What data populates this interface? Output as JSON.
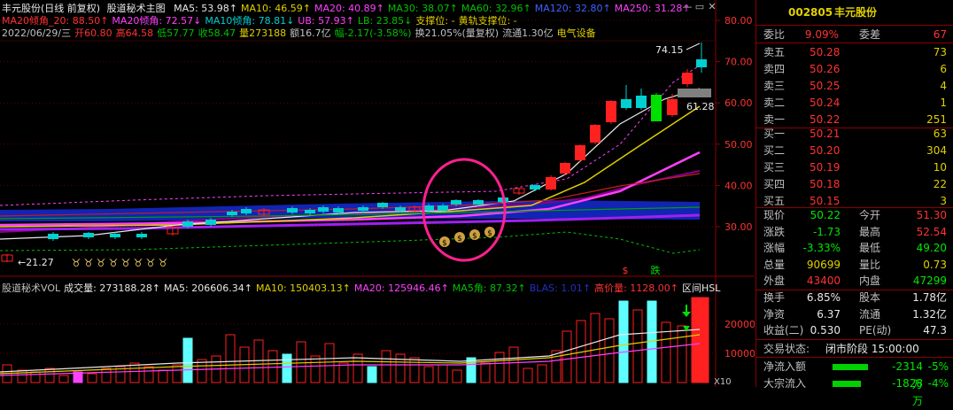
{
  "stock": {
    "code": "002805",
    "name": "丰元股份"
  },
  "chart_header": {
    "title": "丰元股份(日线 前复权)",
    "indicator": "股道秘术主图",
    "ma_items": [
      {
        "label": "MA5: 53.98↑",
        "color": "#e8e8e8"
      },
      {
        "label": "MA10: 46.59↑",
        "color": "#e0d000"
      },
      {
        "label": "MA20: 40.89↑",
        "color": "#ff40ff"
      },
      {
        "label": "MA30: 38.07↑",
        "color": "#00c000"
      },
      {
        "label": "MA60: 32.96↑",
        "color": "#00c000"
      },
      {
        "label": "MA120: 32.80↑",
        "color": "#4060ff"
      },
      {
        "label": "MA250: 31.28↑",
        "color": "#ff40ff"
      }
    ],
    "row2_items": [
      {
        "label": "MA20倾角_20: 88.50↑",
        "color": "#ff3232"
      },
      {
        "label": "MA20倾角: 72.57↓",
        "color": "#ff40ff"
      },
      {
        "label": "MA10倾角: 78.81↓",
        "color": "#00d0d0"
      },
      {
        "label": "UB: 57.93↑",
        "color": "#ff40ff"
      },
      {
        "label": "LB: 23.85↓",
        "color": "#00c000"
      },
      {
        "label": "支撑位: -",
        "color": "#e0d000"
      },
      {
        "label": "黄轨支撑位: -",
        "color": "#e0d000"
      }
    ],
    "row3_items": [
      {
        "label": "2022/06/29/三",
        "color": "#c0c0c0"
      },
      {
        "label": "开60.80",
        "color": "#ff3232"
      },
      {
        "label": "高64.58",
        "color": "#ff3232"
      },
      {
        "label": "低57.77",
        "color": "#00c000"
      },
      {
        "label": "收58.47",
        "color": "#00c000"
      },
      {
        "label": "量273188",
        "color": "#e0d000"
      },
      {
        "label": "额16.7亿",
        "color": "#c0c0c0"
      },
      {
        "label": "幅-2.17(-3.58%)",
        "color": "#00c000"
      },
      {
        "label": "换21.05%(量复权)",
        "color": "#c0c0c0"
      },
      {
        "label": "流通1.30亿",
        "color": "#c0c0c0"
      },
      {
        "label": "电气设备",
        "color": "#e0d000"
      }
    ]
  },
  "price_axis": {
    "ticks": [
      "80.00",
      "70.00",
      "60.00",
      "50.00",
      "40.00",
      "30.00"
    ]
  },
  "annotations": {
    "high_label": "74.15",
    "low_label": "21.27",
    "mid_label": "61.28",
    "marker_s": "$",
    "marker_die": "跌"
  },
  "volume_header": {
    "items": [
      {
        "label": "股道秘术VOL",
        "color": "#c0c0c0"
      },
      {
        "label": "成交量: 273188.28↑",
        "color": "#e8e8e8"
      },
      {
        "label": "MA5: 206606.34↑",
        "color": "#e8e8e8"
      },
      {
        "label": "MA10: 150403.13↑",
        "color": "#e0d000"
      },
      {
        "label": "MA20: 125946.46↑",
        "color": "#ff40ff"
      },
      {
        "label": "MA5角: 87.32↑",
        "color": "#00c000"
      },
      {
        "label": "BLAS: 1.01↑",
        "color": "#2030c0"
      },
      {
        "label": "高价量: 1128.00↑",
        "color": "#ff3232"
      },
      {
        "label": "区间HSL",
        "color": "#e8e8e8"
      }
    ]
  },
  "volume_axis": {
    "ticks": [
      "20000",
      "10000"
    ],
    "unit": "X10"
  },
  "quote": {
    "ratio": {
      "label1": "委比",
      "value1": "9.09%",
      "label2": "委差",
      "value2": "67"
    },
    "asks": [
      {
        "label": "卖五",
        "price": "50.28",
        "vol": "73"
      },
      {
        "label": "卖四",
        "price": "50.26",
        "vol": "6"
      },
      {
        "label": "卖三",
        "price": "50.25",
        "vol": "4"
      },
      {
        "label": "卖二",
        "price": "50.24",
        "vol": "1"
      },
      {
        "label": "卖一",
        "price": "50.22",
        "vol": "251"
      }
    ],
    "bids": [
      {
        "label": "买一",
        "price": "50.21",
        "vol": "63"
      },
      {
        "label": "买二",
        "price": "50.20",
        "vol": "304"
      },
      {
        "label": "买三",
        "price": "50.19",
        "vol": "10"
      },
      {
        "label": "买四",
        "price": "50.18",
        "vol": "22"
      },
      {
        "label": "买五",
        "price": "50.15",
        "vol": "3"
      }
    ],
    "stats1": [
      {
        "l1": "现价",
        "v1": "50.22",
        "c1": "green",
        "l2": "今开",
        "v2": "51.30",
        "c2": "red"
      },
      {
        "l1": "涨跌",
        "v1": "-1.73",
        "c1": "green",
        "l2": "最高",
        "v2": "52.54",
        "c2": "red"
      },
      {
        "l1": "涨幅",
        "v1": "-3.33%",
        "c1": "green",
        "l2": "最低",
        "v2": "49.20",
        "c2": "green"
      },
      {
        "l1": "总量",
        "v1": "90699",
        "c1": "yellow",
        "l2": "量比",
        "v2": "0.73",
        "c2": "yellow"
      },
      {
        "l1": "外盘",
        "v1": "43400",
        "c1": "red",
        "l2": "内盘",
        "v2": "47299",
        "c2": "green"
      }
    ],
    "stats2": [
      {
        "l1": "换手",
        "v1": "6.85%",
        "c1": "white",
        "l2": "股本",
        "v2": "1.78亿",
        "c2": "white"
      },
      {
        "l1": "净资",
        "v1": "6.37",
        "c1": "white",
        "l2": "流通",
        "v2": "1.32亿",
        "c2": "white"
      },
      {
        "l1": "收益(二)",
        "v1": "0.530",
        "c1": "white",
        "l2": "PE(动)",
        "v2": "47.3",
        "c2": "white"
      }
    ],
    "trade_status": {
      "label": "交易状态:",
      "value": "闭市阶段 15:00:00"
    },
    "flows": [
      {
        "label": "净流入额",
        "value": "-2314万",
        "pct": "-5%",
        "fill": 0.55
      },
      {
        "label": "大宗流入",
        "value": "-1828万",
        "pct": "-4%",
        "fill": 0.45
      }
    ]
  },
  "colors": {
    "up": "#ff3232",
    "down": "#00d0d0",
    "bg": "#000000",
    "border": "#8b0000"
  }
}
